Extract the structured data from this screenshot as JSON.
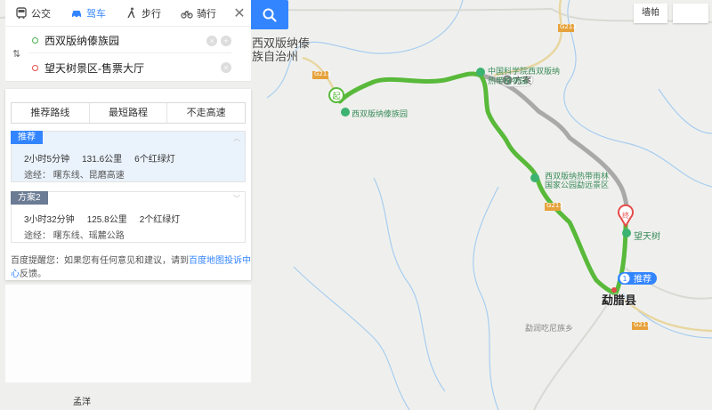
{
  "modes": [
    {
      "key": "bus",
      "label": "公交"
    },
    {
      "key": "car",
      "label": "驾车"
    },
    {
      "key": "walk",
      "label": "步行"
    },
    {
      "key": "bike",
      "label": "骑行"
    }
  ],
  "active_mode": "car",
  "search": {
    "start": "西双版纳傣族园",
    "end": "望天树景区-售票大厅"
  },
  "route_tabs": [
    "推荐路线",
    "最短路程",
    "不走高速"
  ],
  "routes": [
    {
      "badge": "推荐",
      "time": "2小时5分钟",
      "distance": "131.6公里",
      "lights": "6个红绿灯",
      "via": "途经：  曙东线、昆磨高速"
    },
    {
      "badge": "方案2",
      "time": "3小时32分钟",
      "distance": "125.8公里",
      "lights": "2个红绿灯",
      "via": "途经：  曙东线、瑶麓公路"
    }
  ],
  "feedback": {
    "text": "百度提醒您：如果您有任何意见和建议，请到",
    "link": "百度地图投诉中心",
    "suffix": "反馈。"
  },
  "map_labels": {
    "region": [
      "西双版纳傣",
      "族自治州"
    ],
    "start_poi": "西双版纳傣族园",
    "park1": "中国科学院西双版纳",
    "park1b": "热带植物园",
    "park2": "西双版纳热带雨林",
    "park2b": "国家公园勐远景区",
    "end_poi": "望天树",
    "county": "勐腊县",
    "town": "勐润吃尼族乡",
    "bottom_town": "孟洋",
    "plan2_tag": "方案",
    "plan2_num": "2",
    "rec_tag": "推荐",
    "rec_num": "1",
    "start_marker": "起",
    "end_marker": "终",
    "roads": [
      "G213",
      "G213",
      "G213",
      "G213"
    ]
  },
  "controls": {
    "zoom_label": "墙帕"
  },
  "colors": {
    "route_main": "#59b93a",
    "route_alt": "#a9a9a9",
    "accent": "#3385ff",
    "water": "#a8cdf0"
  }
}
